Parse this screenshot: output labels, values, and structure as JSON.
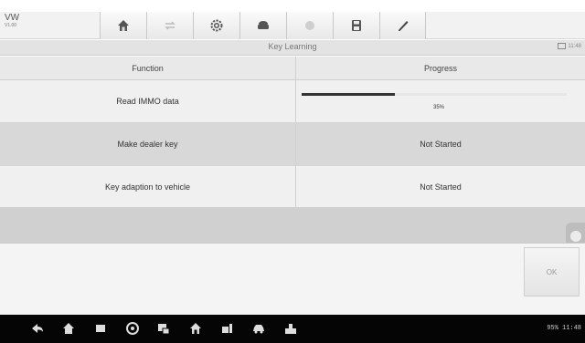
{
  "header": {
    "make": "VW",
    "version": "V1.00",
    "toolbar": [
      {
        "icon": "home-icon"
      },
      {
        "icon": "vehicle-swap-icon"
      },
      {
        "icon": "settings-icon"
      },
      {
        "icon": "print-icon"
      },
      {
        "icon": "help-icon"
      },
      {
        "icon": "save-icon"
      },
      {
        "icon": "edit-icon"
      }
    ]
  },
  "titlebar": {
    "title": "Key Learning",
    "right_info": "11:48"
  },
  "table": {
    "columns": [
      "Function",
      "Progress"
    ],
    "rows": [
      {
        "function": "Read IMMO data",
        "progress_text": "35%",
        "progress_value": 0.35
      },
      {
        "function": "Make dealer key",
        "progress_text": "Not Started"
      },
      {
        "function": "Key adaption to vehicle",
        "progress_text": "Not Started"
      }
    ]
  },
  "footer": {
    "ok_label": "OK"
  },
  "navbar": {
    "icons": [
      "back-icon",
      "home-icon",
      "recent-apps-icon",
      "browser-icon",
      "screenshot-icon",
      "autel-home-icon",
      "vci-icon",
      "car-icon",
      "shop-icon"
    ],
    "status_text": "95% 11:48"
  },
  "colors": {
    "toolbar_bg": "#f2f2f2",
    "row_odd": "#f0f0f0",
    "row_even": "#d8d8d8",
    "progress_fill": "#333333",
    "navbar_bg": "#050505"
  }
}
